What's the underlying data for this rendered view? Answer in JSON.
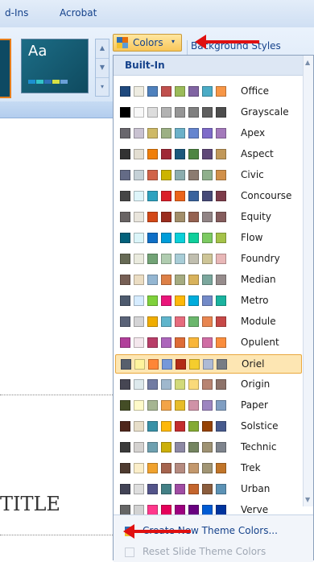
{
  "ribbon": {
    "tabs": [
      "d-Ins",
      "Acrobat"
    ],
    "colors_button": {
      "label": "Colors",
      "caret": "▾"
    },
    "background_styles_label": "Background Styles",
    "theme_thumb_label": "Aa"
  },
  "slide": {
    "title": "TITLE"
  },
  "menu": {
    "header": "Built-In",
    "schemes": [
      {
        "name": "Office",
        "colors": [
          "#1f497d",
          "#eeece1",
          "#4f81bd",
          "#c0504d",
          "#9bbb59",
          "#8064a2",
          "#4bacc6",
          "#f79646"
        ]
      },
      {
        "name": "Grayscale",
        "colors": [
          "#000000",
          "#f8f8f8",
          "#dddddd",
          "#b2b2b2",
          "#969696",
          "#808080",
          "#5f5f5f",
          "#4d4d4d"
        ]
      },
      {
        "name": "Apex",
        "colors": [
          "#69676d",
          "#c9c2d1",
          "#ceb966",
          "#9cb084",
          "#6bb1c9",
          "#6585cf",
          "#7e6bc9",
          "#a379bb"
        ]
      },
      {
        "name": "Aspect",
        "colors": [
          "#323232",
          "#e3ded1",
          "#f07f09",
          "#9f2936",
          "#1b587c",
          "#4e8542",
          "#604878",
          "#c19859"
        ]
      },
      {
        "name": "Civic",
        "colors": [
          "#646b86",
          "#c5d1d7",
          "#d16349",
          "#ccb400",
          "#8cadae",
          "#8c7b70",
          "#8fb08c",
          "#d19049"
        ]
      },
      {
        "name": "Concourse",
        "colors": [
          "#464646",
          "#def5fa",
          "#2da2bf",
          "#da1f28",
          "#eb641b",
          "#39639d",
          "#474b78",
          "#7d3c4a"
        ]
      },
      {
        "name": "Equity",
        "colors": [
          "#696464",
          "#e9e5dc",
          "#d34817",
          "#9b2d1f",
          "#a28e6a",
          "#956251",
          "#918485",
          "#855d5d"
        ]
      },
      {
        "name": "Flow",
        "colors": [
          "#04617b",
          "#dbf5f9",
          "#0f6fc6",
          "#009dd9",
          "#0bd0d9",
          "#10cf9b",
          "#7cca62",
          "#a5c249"
        ]
      },
      {
        "name": "Foundry",
        "colors": [
          "#676a55",
          "#eaebde",
          "#72a376",
          "#b0ccb0",
          "#a8cdd7",
          "#c0beaf",
          "#cec597",
          "#e8b7b7"
        ]
      },
      {
        "name": "Median",
        "colors": [
          "#775f55",
          "#ebddc3",
          "#94b6d2",
          "#dd8047",
          "#a5ab81",
          "#d8b25c",
          "#7ba79d",
          "#968c8c"
        ]
      },
      {
        "name": "Metro",
        "colors": [
          "#4e5b6f",
          "#d6ecff",
          "#7fd13b",
          "#ea157a",
          "#feb80a",
          "#00addc",
          "#738ac8",
          "#1ab39f"
        ]
      },
      {
        "name": "Module",
        "colors": [
          "#5a6378",
          "#d4d4d6",
          "#f0ad00",
          "#60b5cc",
          "#e66c7d",
          "#6bb76d",
          "#e88651",
          "#c64847"
        ]
      },
      {
        "name": "Opulent",
        "colors": [
          "#b13f9a",
          "#f4e7ed",
          "#b83d68",
          "#ac66bb",
          "#de6c36",
          "#f9b639",
          "#cf6da4",
          "#fa8d3d"
        ]
      },
      {
        "name": "Oriel",
        "colors": [
          "#575f6d",
          "#fff39d",
          "#fe8637",
          "#7598d9",
          "#b32c16",
          "#f5cd2d",
          "#aebad5",
          "#777c84"
        ]
      },
      {
        "name": "Origin",
        "colors": [
          "#464653",
          "#dde9ec",
          "#727ca3",
          "#9fb8cd",
          "#d2da7a",
          "#fada7a",
          "#b88472",
          "#8e736a"
        ]
      },
      {
        "name": "Paper",
        "colors": [
          "#444d26",
          "#fefac9",
          "#a5b592",
          "#f3a447",
          "#e7bc29",
          "#d092a7",
          "#9c85c0",
          "#809ec2"
        ]
      },
      {
        "name": "Solstice",
        "colors": [
          "#4f271c",
          "#e7dec9",
          "#3891a7",
          "#feb80a",
          "#c32d2e",
          "#84aa33",
          "#964305",
          "#475a8d"
        ]
      },
      {
        "name": "Technic",
        "colors": [
          "#3b3b3b",
          "#d4d2d0",
          "#6ea0b0",
          "#ccaf0a",
          "#8d89a4",
          "#748560",
          "#9e9273",
          "#7e848d"
        ]
      },
      {
        "name": "Trek",
        "colors": [
          "#4e3b30",
          "#fbeec9",
          "#f0a22e",
          "#a5644e",
          "#b58b80",
          "#c3986d",
          "#a19574",
          "#c17529"
        ]
      },
      {
        "name": "Urban",
        "colors": [
          "#424456",
          "#dedede",
          "#53548a",
          "#438086",
          "#a04da3",
          "#c4652d",
          "#8b5d3d",
          "#5c92b5"
        ]
      },
      {
        "name": "Verve",
        "colors": [
          "#666666",
          "#d2d2d2",
          "#ff388c",
          "#e40059",
          "#9c007f",
          "#68007f",
          "#005bd3",
          "#00349e"
        ]
      }
    ],
    "selected_scheme": "Oriel",
    "footer": {
      "create_label": "Create New Theme Colors...",
      "reset_label": "Reset Slide Theme Colors"
    }
  },
  "colors": {
    "arrow": "#e01010",
    "highlight": "#fde6b3",
    "ribbon_text": "#15428b"
  }
}
